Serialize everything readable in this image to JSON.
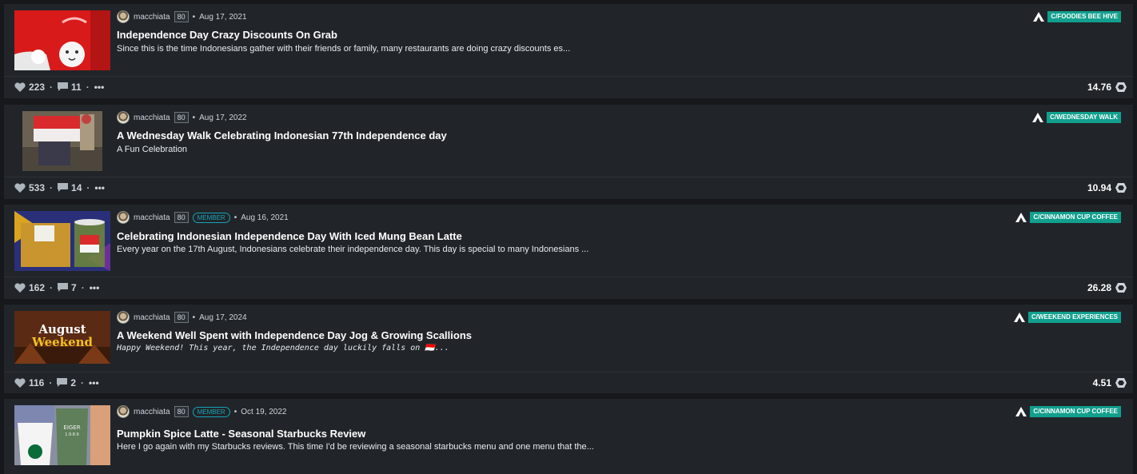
{
  "posts": [
    {
      "author": "macchiata",
      "reputation": "80",
      "member": "",
      "date": "Aug 17, 2021",
      "title": "Independence Day Crazy Discounts On Grab",
      "excerpt": "Since this is the time Indonesians gather with their friends or family, many restaurants are doing crazy discounts es...",
      "community": "C/FOODIES BEE HIVE",
      "likes": "223",
      "comments": "11",
      "more": "•••",
      "payout": "14.76",
      "thumb_icon": "red-bag-image"
    },
    {
      "author": "macchiata",
      "reputation": "80",
      "member": "",
      "date": "Aug 17, 2022",
      "title": "A Wednesday Walk Celebrating Indonesian 77th Independence day",
      "excerpt": "A Fun Celebration",
      "community": "C/WEDNESDAY WALK",
      "likes": "533",
      "comments": "14",
      "more": "•••",
      "payout": "10.94",
      "thumb_icon": "flag-walk-image"
    },
    {
      "author": "macchiata",
      "reputation": "80",
      "member": "MEMBER",
      "date": "Aug 16, 2021",
      "title": "Celebrating Indonesian Independence Day With Iced Mung Bean Latte",
      "excerpt": "Every year on the 17th August, Indonesians celebrate their independence day. This day is special to many Indonesians ...",
      "community": "C/CINNAMON CUP COFFEE",
      "likes": "162",
      "comments": "7",
      "more": "•••",
      "payout": "26.28",
      "thumb_icon": "latte-image"
    },
    {
      "author": "macchiata",
      "reputation": "80",
      "member": "",
      "date": "Aug 17, 2024",
      "title": "A Weekend Well Spent with Independence Day Jog & Growing Scallions",
      "excerpt": "Happy Weekend! This year, the Independence day luckily falls on 🇮🇩...",
      "community": "C/WEEKEND EXPERIENCES",
      "likes": "116",
      "comments": "2",
      "more": "•••",
      "payout": "4.51",
      "thumb_icon": "august-weekend-image",
      "thumb_text_1": "August",
      "thumb_text_2": "Weekend"
    },
    {
      "author": "macchiata",
      "reputation": "80",
      "member": "MEMBER",
      "date": "Oct 19, 2022",
      "title": "Pumpkin Spice Latte - Seasonal Starbucks Review",
      "excerpt": "Here I go again with my Starbucks reviews. This time I'd be reviewing a seasonal starbucks menu and one menu that the...",
      "community": "C/CINNAMON CUP COFFEE",
      "likes": "",
      "comments": "",
      "more": "",
      "payout": "",
      "thumb_icon": "starbucks-cups-image",
      "thumb_text_1": "EIGER",
      "thumb_text_2": "1.9.8.9"
    }
  ],
  "colors": {
    "background": "#16181b",
    "card": "#212529",
    "community_badge": "#129f8e",
    "member_badge": "#17a2b8"
  }
}
